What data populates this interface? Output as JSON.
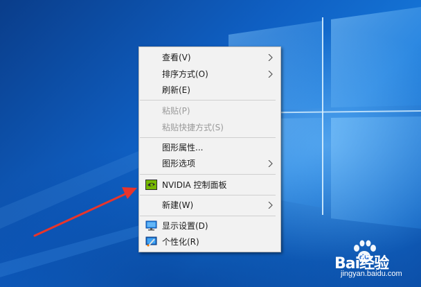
{
  "desktop": {
    "accent_color": "#0f5fc2"
  },
  "context_menu": {
    "items": [
      {
        "label": "查看(V)",
        "submenu": true,
        "enabled": true
      },
      {
        "label": "排序方式(O)",
        "submenu": true,
        "enabled": true
      },
      {
        "label": "刷新(E)",
        "submenu": false,
        "enabled": true
      },
      {
        "label": "粘贴(P)",
        "submenu": false,
        "enabled": false
      },
      {
        "label": "粘贴快捷方式(S)",
        "submenu": false,
        "enabled": false
      },
      {
        "label": "图形属性...",
        "submenu": false,
        "enabled": true
      },
      {
        "label": "图形选项",
        "submenu": true,
        "enabled": true
      },
      {
        "label": "NVIDIA 控制面板",
        "submenu": false,
        "enabled": true,
        "icon": "nvidia-icon"
      },
      {
        "label": "新建(W)",
        "submenu": true,
        "enabled": true
      },
      {
        "label": "显示设置(D)",
        "submenu": false,
        "enabled": true,
        "icon": "display-settings-icon"
      },
      {
        "label": "个性化(R)",
        "submenu": false,
        "enabled": true,
        "icon": "personalize-icon"
      }
    ]
  },
  "annotation": {
    "arrow_color": "#e8352b",
    "icon": "red-arrow-icon"
  },
  "watermark": {
    "brand": "Bai经验",
    "site": "jingyan.baidu.com"
  }
}
